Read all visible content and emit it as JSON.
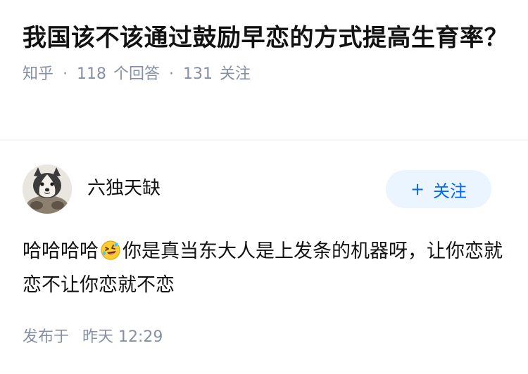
{
  "question": {
    "title": "我国该不该通过鼓励早恋的方式提高生育率？",
    "source": "知乎",
    "separator": "·",
    "answer_count": "118",
    "answer_count_label": "个回答",
    "follower_count": "131",
    "follower_label": "关注"
  },
  "answer": {
    "author_name": "六独天缺",
    "follow_plus": "+",
    "follow_label": "关注",
    "text_before_emoji": "哈哈哈哈",
    "emoji": "rolling-on-floor-laughing-icon",
    "text_after_emoji": "你是真当东大人是上发条的机器呀，让你恋就恋不让你恋就不恋",
    "time_prefix": "发布于",
    "time_value": "昨天 12:29"
  },
  "colors": {
    "title": "#121212",
    "meta": "#8590a6",
    "follow_bg": "#ebf5ff",
    "follow_text": "#0066ff",
    "divider": "#f6f6f6"
  }
}
